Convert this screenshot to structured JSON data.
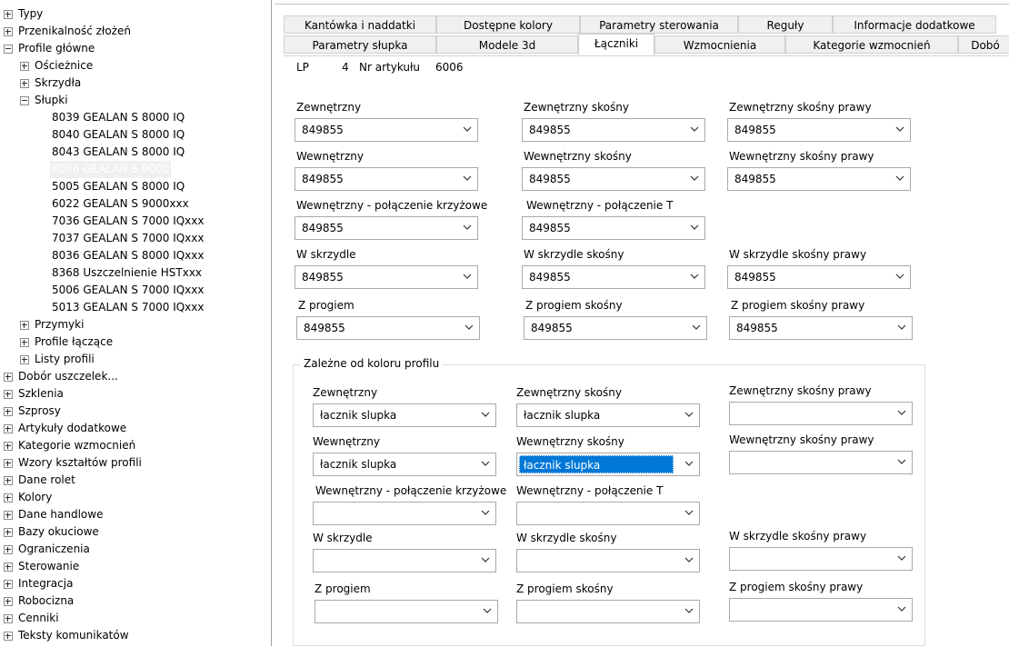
{
  "tree": {
    "items": [
      {
        "label": "Typy",
        "level": 0,
        "expander": "plus"
      },
      {
        "label": "Przenikalność złożeń",
        "level": 0,
        "expander": "plus"
      },
      {
        "label": "Profile główne",
        "level": 0,
        "expander": "minus"
      },
      {
        "label": "Ościeżnice",
        "level": 1,
        "expander": "plus"
      },
      {
        "label": "Skrzydła",
        "level": 1,
        "expander": "plus"
      },
      {
        "label": "Słupki",
        "level": 1,
        "expander": "minus"
      },
      {
        "label": "8039 GEALAN S 8000 IQ",
        "level": 2,
        "expander": "none"
      },
      {
        "label": "8040 GEALAN S 8000 IQ",
        "level": 2,
        "expander": "none"
      },
      {
        "label": "8043 GEALAN S 8000 IQ",
        "level": 2,
        "expander": "none"
      },
      {
        "label": "6006 GEALAN S 9000",
        "level": 2,
        "expander": "none",
        "selected": true
      },
      {
        "label": "5005 GEALAN S 8000 IQ",
        "level": 2,
        "expander": "none"
      },
      {
        "label": "6022 GEALAN S 9000xxx",
        "level": 2,
        "expander": "none"
      },
      {
        "label": "7036 GEALAN S 7000 IQxxx",
        "level": 2,
        "expander": "none"
      },
      {
        "label": "7037 GEALAN S 7000 IQxxx",
        "level": 2,
        "expander": "none"
      },
      {
        "label": "8036 GEALAN S 8000 IQxxx",
        "level": 2,
        "expander": "none"
      },
      {
        "label": "8368 Uszczelnienie HSTxxx",
        "level": 2,
        "expander": "none"
      },
      {
        "label": "5006 GEALAN S 7000 IQxxx",
        "level": 2,
        "expander": "none"
      },
      {
        "label": "5013 GEALAN S 7000 IQxxx",
        "level": 2,
        "expander": "none"
      },
      {
        "label": "Przymyki",
        "level": 1,
        "expander": "plus"
      },
      {
        "label": "Profile łączące",
        "level": 1,
        "expander": "plus"
      },
      {
        "label": "Listy profili",
        "level": 1,
        "expander": "plus"
      },
      {
        "label": "Dobór uszczelek...",
        "level": 0,
        "expander": "plus"
      },
      {
        "label": "Szklenia",
        "level": 0,
        "expander": "plus"
      },
      {
        "label": "Szprosy",
        "level": 0,
        "expander": "plus"
      },
      {
        "label": "Artykuły dodatkowe",
        "level": 0,
        "expander": "plus"
      },
      {
        "label": "Kategorie wzmocnień",
        "level": 0,
        "expander": "plus"
      },
      {
        "label": "Wzory kształtów profili",
        "level": 0,
        "expander": "plus"
      },
      {
        "label": "Dane rolet",
        "level": 0,
        "expander": "plus"
      },
      {
        "label": "Kolory",
        "level": 0,
        "expander": "plus"
      },
      {
        "label": "Dane handlowe",
        "level": 0,
        "expander": "plus"
      },
      {
        "label": "Bazy okuciowe",
        "level": 0,
        "expander": "plus"
      },
      {
        "label": "Ograniczenia",
        "level": 0,
        "expander": "plus"
      },
      {
        "label": "Sterowanie",
        "level": 0,
        "expander": "plus"
      },
      {
        "label": "Integracja",
        "level": 0,
        "expander": "plus"
      },
      {
        "label": "Robocizna",
        "level": 0,
        "expander": "plus"
      },
      {
        "label": "Cenniki",
        "level": 0,
        "expander": "plus"
      },
      {
        "label": "Teksty komunikatów",
        "level": 0,
        "expander": "plus"
      }
    ]
  },
  "tabs": {
    "row1": [
      "Kantówka i naddatki",
      "Dostępne kolory",
      "Parametry sterowania",
      "Reguły",
      "Informacje dodatkowe"
    ],
    "row2": [
      "Parametry słupka",
      "Modele 3d",
      "Łączniki",
      "Wzmocnienia",
      "Kategorie wzmocnień",
      "Dobó"
    ],
    "active": "Łączniki"
  },
  "header": {
    "lp_label": "LP",
    "lp_value": "4",
    "art_label": "Nr artykułu",
    "art_value": "6006"
  },
  "main_fields": [
    {
      "label": "Zewnętrzny",
      "value": "849855"
    },
    {
      "label": "Zewnętrzny skośny",
      "value": "849855"
    },
    {
      "label": "Zewnętrzny skośny prawy",
      "value": "849855"
    },
    {
      "label": "Wewnętrzny",
      "value": "849855"
    },
    {
      "label": "Wewnętrzny skośny",
      "value": "849855"
    },
    {
      "label": "Wewnętrzny skośny prawy",
      "value": "849855"
    },
    {
      "label": "Wewnętrzny - połączenie krzyżowe",
      "value": "849855"
    },
    {
      "label": "Wewnętrzny - połączenie T",
      "value": "849855"
    },
    {
      "label": "W skrzydle",
      "value": "849855"
    },
    {
      "label": "W skrzydle skośny",
      "value": "849855"
    },
    {
      "label": "W skrzydle skośny prawy",
      "value": "849855"
    },
    {
      "label": "Z progiem",
      "value": "849855"
    },
    {
      "label": "Z progiem skośny",
      "value": "849855"
    },
    {
      "label": "Z progiem skośny prawy",
      "value": "849855"
    }
  ],
  "color_group": {
    "title": "Zależne od koloru profilu",
    "fields": [
      {
        "label": "Zewnętrzny",
        "value": "łacznik slupka"
      },
      {
        "label": "Zewnętrzny skośny",
        "value": "łacznik slupka"
      },
      {
        "label": "Zewnętrzny skośny prawy",
        "value": ""
      },
      {
        "label": "Wewnętrzny",
        "value": "łacznik slupka"
      },
      {
        "label": "Wewnętrzny skośny",
        "value": "łacznik slupka",
        "highlighted": true
      },
      {
        "label": "Wewnętrzny skośny prawy",
        "value": ""
      },
      {
        "label": "Wewnętrzny - połączenie krzyżowe",
        "value": ""
      },
      {
        "label": "Wewnętrzny - połączenie T",
        "value": ""
      },
      {
        "label": "W skrzydle",
        "value": ""
      },
      {
        "label": "W skrzydle skośny",
        "value": ""
      },
      {
        "label": "W skrzydle skośny prawy",
        "value": ""
      },
      {
        "label": "Z progiem",
        "value": ""
      },
      {
        "label": "Z progiem skośny",
        "value": ""
      },
      {
        "label": "Z progiem skośny prawy",
        "value": ""
      }
    ]
  },
  "colors": {
    "selection": "#0078d7",
    "tab_bg": "#f0f0f0"
  },
  "icons": {
    "expander_plus": "plus-box-icon",
    "expander_minus": "minus-box-icon",
    "dropdown": "chevron-down-icon"
  }
}
